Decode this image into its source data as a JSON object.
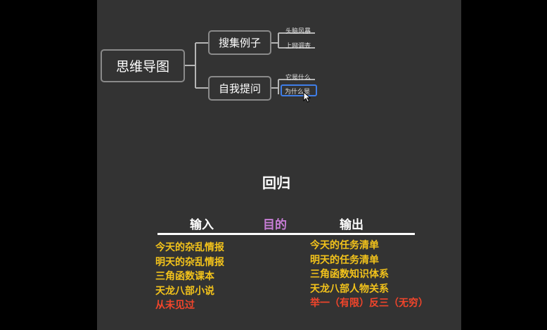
{
  "mindmap": {
    "root": "思维导图",
    "branches": [
      {
        "label": "搜集例子",
        "leaves": [
          "头脑风暴",
          "上网调查"
        ]
      },
      {
        "label": "自我提问",
        "leaves": [
          "它是什么",
          "为什么是"
        ]
      }
    ],
    "selected_leaf": "为什么是"
  },
  "slide": {
    "title": "回归",
    "headers": {
      "input": "输入",
      "purpose": "目的",
      "output": "输出"
    },
    "inputs": [
      "今天的杂乱情报",
      "明天的杂乱情报",
      "三角函数课本",
      "天龙八部小说",
      "从未见过"
    ],
    "outputs": [
      "今天的任务清单",
      "明天的任务清单",
      "三角函数知识体系",
      "天龙八部人物关系",
      "举一（有限）反三（无穷）"
    ]
  },
  "colors": {
    "item_text": "#f2c21b",
    "highlight_text": "#f2452b",
    "purpose_header": "#c77dd6",
    "selection_border": "#3f7ee8"
  }
}
